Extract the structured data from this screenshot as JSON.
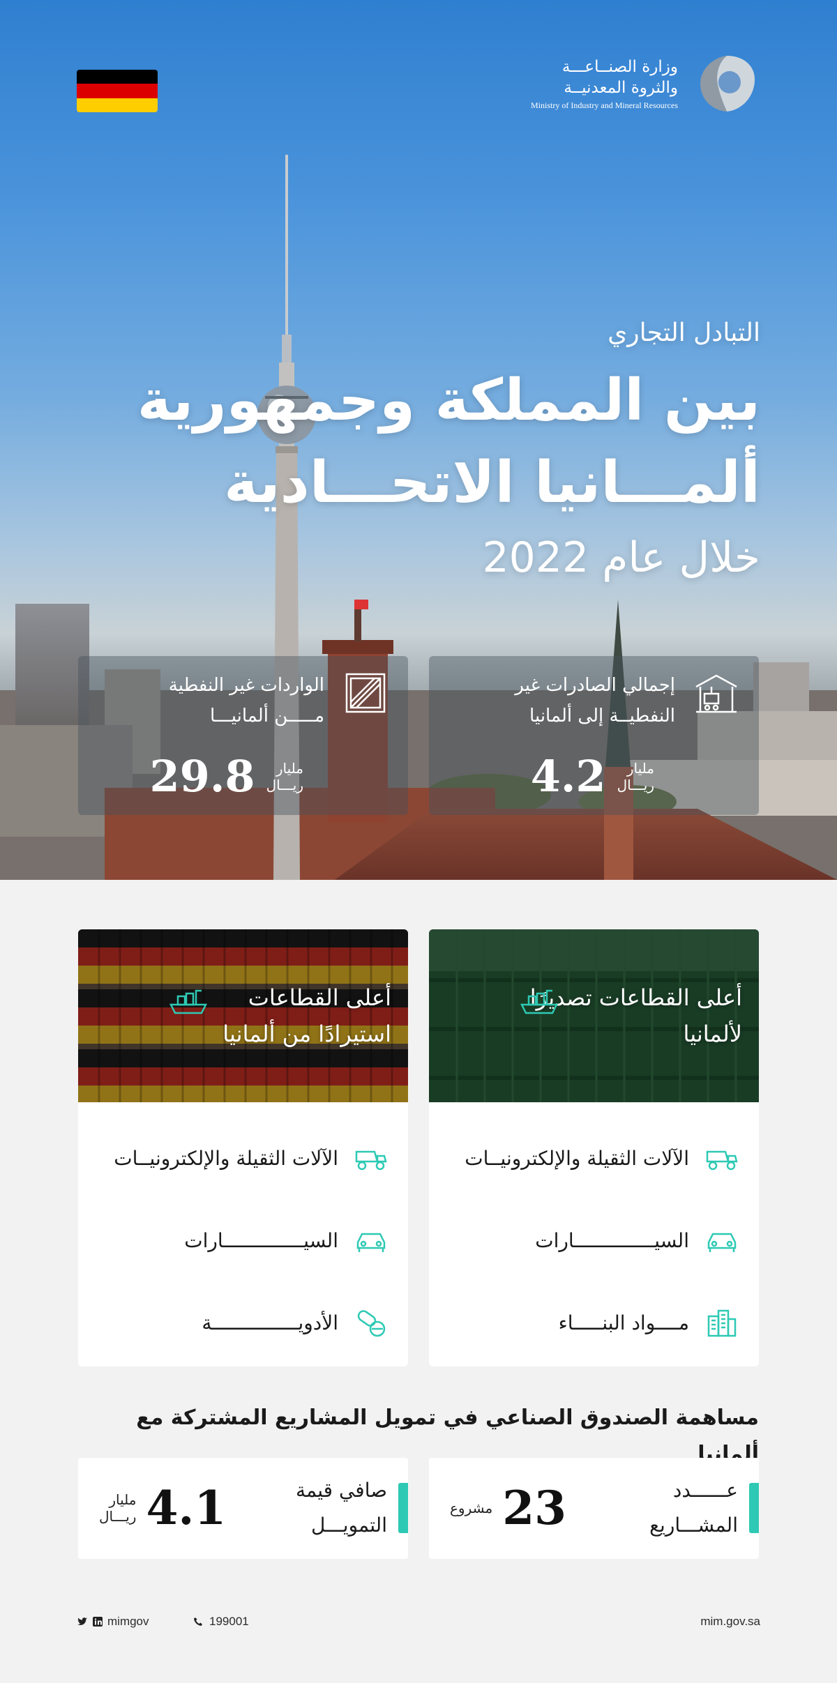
{
  "header": {
    "ministry_ar_line1": "وزارة الصنــاعـــة",
    "ministry_ar_line2": "والثروة المعدنيــة",
    "ministry_en": "Ministry of Industry and Mineral Resources",
    "logo_icon": "ministry-ribbon-logo",
    "flag_icon": "germany-flag"
  },
  "hero": {
    "kicker": "التبادل التجاري",
    "title_line1": "بين المملكة وجمهورية",
    "title_line2": "ألمـــانيا الاتحـــادية",
    "subtitle": "خلال عام 2022"
  },
  "stats": {
    "exports": {
      "label_line1": "إجمالي الصادرات غير",
      "label_line2": "النفطيــة إلى ألمانيا",
      "value": "4.2",
      "unit_line1": "مليار",
      "unit_line2": "ريـــال",
      "icon": "port-crane-icon"
    },
    "imports": {
      "label_line1": "الواردات غير النفطية",
      "label_line2": "مـــــن ألمانيـــا",
      "value": "29.8",
      "unit_line1": "مليار",
      "unit_line2": "ريـــال",
      "icon": "cargo-crate-icon"
    }
  },
  "sectors": {
    "exports": {
      "title": "أعلى القطاعات تصديرًا لألمانيا",
      "icon": "cargo-ship-icon",
      "items": [
        {
          "label": "الآلات الثقيلة والإلكترونيــات",
          "icon": "dump-truck-icon"
        },
        {
          "label": "السيــــــــــــــارات",
          "icon": "car-icon"
        },
        {
          "label": "مــــواد البنـــــاء",
          "icon": "buildings-icon"
        }
      ]
    },
    "imports": {
      "title": "أعلى القطاعات استيرادًا من ألمانيا",
      "icon": "cargo-ship-icon",
      "items": [
        {
          "label": "الآلات الثقيلة والإلكترونيــات",
          "icon": "dump-truck-icon"
        },
        {
          "label": "السيــــــــــــــارات",
          "icon": "car-icon"
        },
        {
          "label": "الأدويـــــــــــــــة",
          "icon": "pills-icon"
        }
      ]
    }
  },
  "fund": {
    "title": "مساهمة الصندوق الصناعي في تمويل المشاريع المشتركة مع ألمانيا",
    "projects": {
      "label_line1": "عــــــدد",
      "label_line2": "المشـــاريع",
      "value": "23",
      "unit": "مشروع"
    },
    "financing": {
      "label_line1": "صافي قيمة",
      "label_line2": "التمويـــل",
      "value": "4.1",
      "unit_line1": "مليار",
      "unit_line2": "ريـــال"
    }
  },
  "footer": {
    "social_handle": "mimgov",
    "phone": "199001",
    "website": "mim.gov.sa"
  },
  "colors": {
    "accent": "#2ec9b4",
    "sky_top": "#2f7fd0",
    "card_bg": "#ffffff",
    "page_bg": "#f2f2f2",
    "flag_black": "#000000",
    "flag_red": "#dd0000",
    "flag_gold": "#ffce00"
  }
}
